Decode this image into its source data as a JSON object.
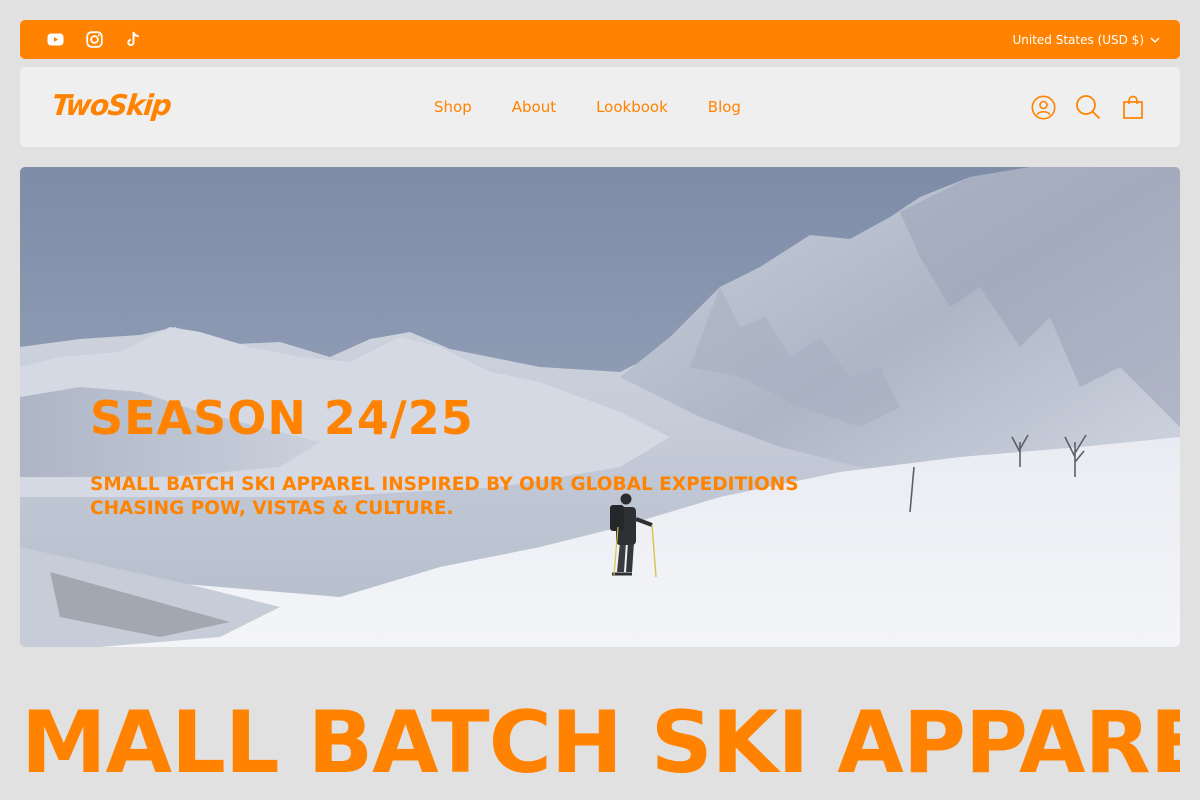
{
  "brand": {
    "name": "TwoSkip",
    "color": "#ff8301"
  },
  "topbar": {
    "socials": [
      {
        "name": "youtube-icon"
      },
      {
        "name": "instagram-icon"
      },
      {
        "name": "tiktok-icon"
      }
    ],
    "currency_label": "United States (USD $)"
  },
  "nav": {
    "items": [
      {
        "label": "Shop"
      },
      {
        "label": "About"
      },
      {
        "label": "Lookbook"
      },
      {
        "label": "Blog"
      }
    ]
  },
  "header_icons": [
    "account-icon",
    "search-icon",
    "cart-icon"
  ],
  "hero": {
    "title": "SEASON 24/25",
    "subtitle": "Small batch ski apparel inspired by our global expeditions chasing pow, vistas & culture."
  },
  "marquee": {
    "text": "SMALL BATCH SKI APPAREL"
  }
}
